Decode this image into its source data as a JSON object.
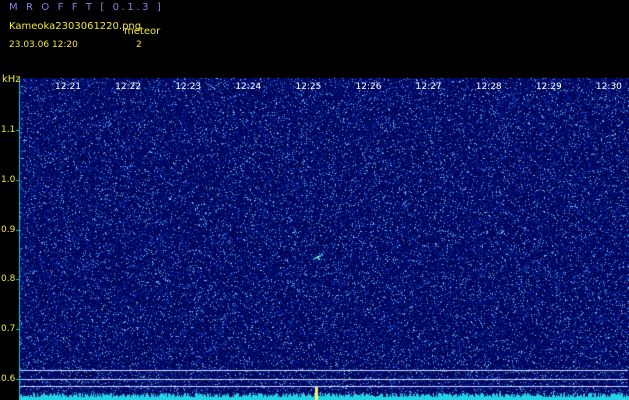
{
  "header": {
    "app_title": "M R O F F T [ 0.1.3 ]",
    "file_name": "Kameoka2303061220.png",
    "meteor_label": "meteor",
    "date_time": "23.03.06 12:20",
    "meteor_count": "2"
  },
  "y_axis": {
    "unit": "kHz",
    "ticks": [
      "1.1",
      "1.0",
      "0.9",
      "0.8",
      "0.7",
      "0.6"
    ]
  },
  "x_axis": {
    "ticks": [
      "12:21",
      "12:22",
      "12:23",
      "12:24",
      "12:25",
      "12:26",
      "12:27",
      "12:28",
      "12:29",
      "12:30"
    ]
  },
  "colors": {
    "background": "#000000",
    "plot_background": "#0b0b6e",
    "noise": "#4f8fe0",
    "header_text": "#f2e832",
    "title_text": "#7f86e8",
    "axis_line": "#19c6d6"
  }
}
